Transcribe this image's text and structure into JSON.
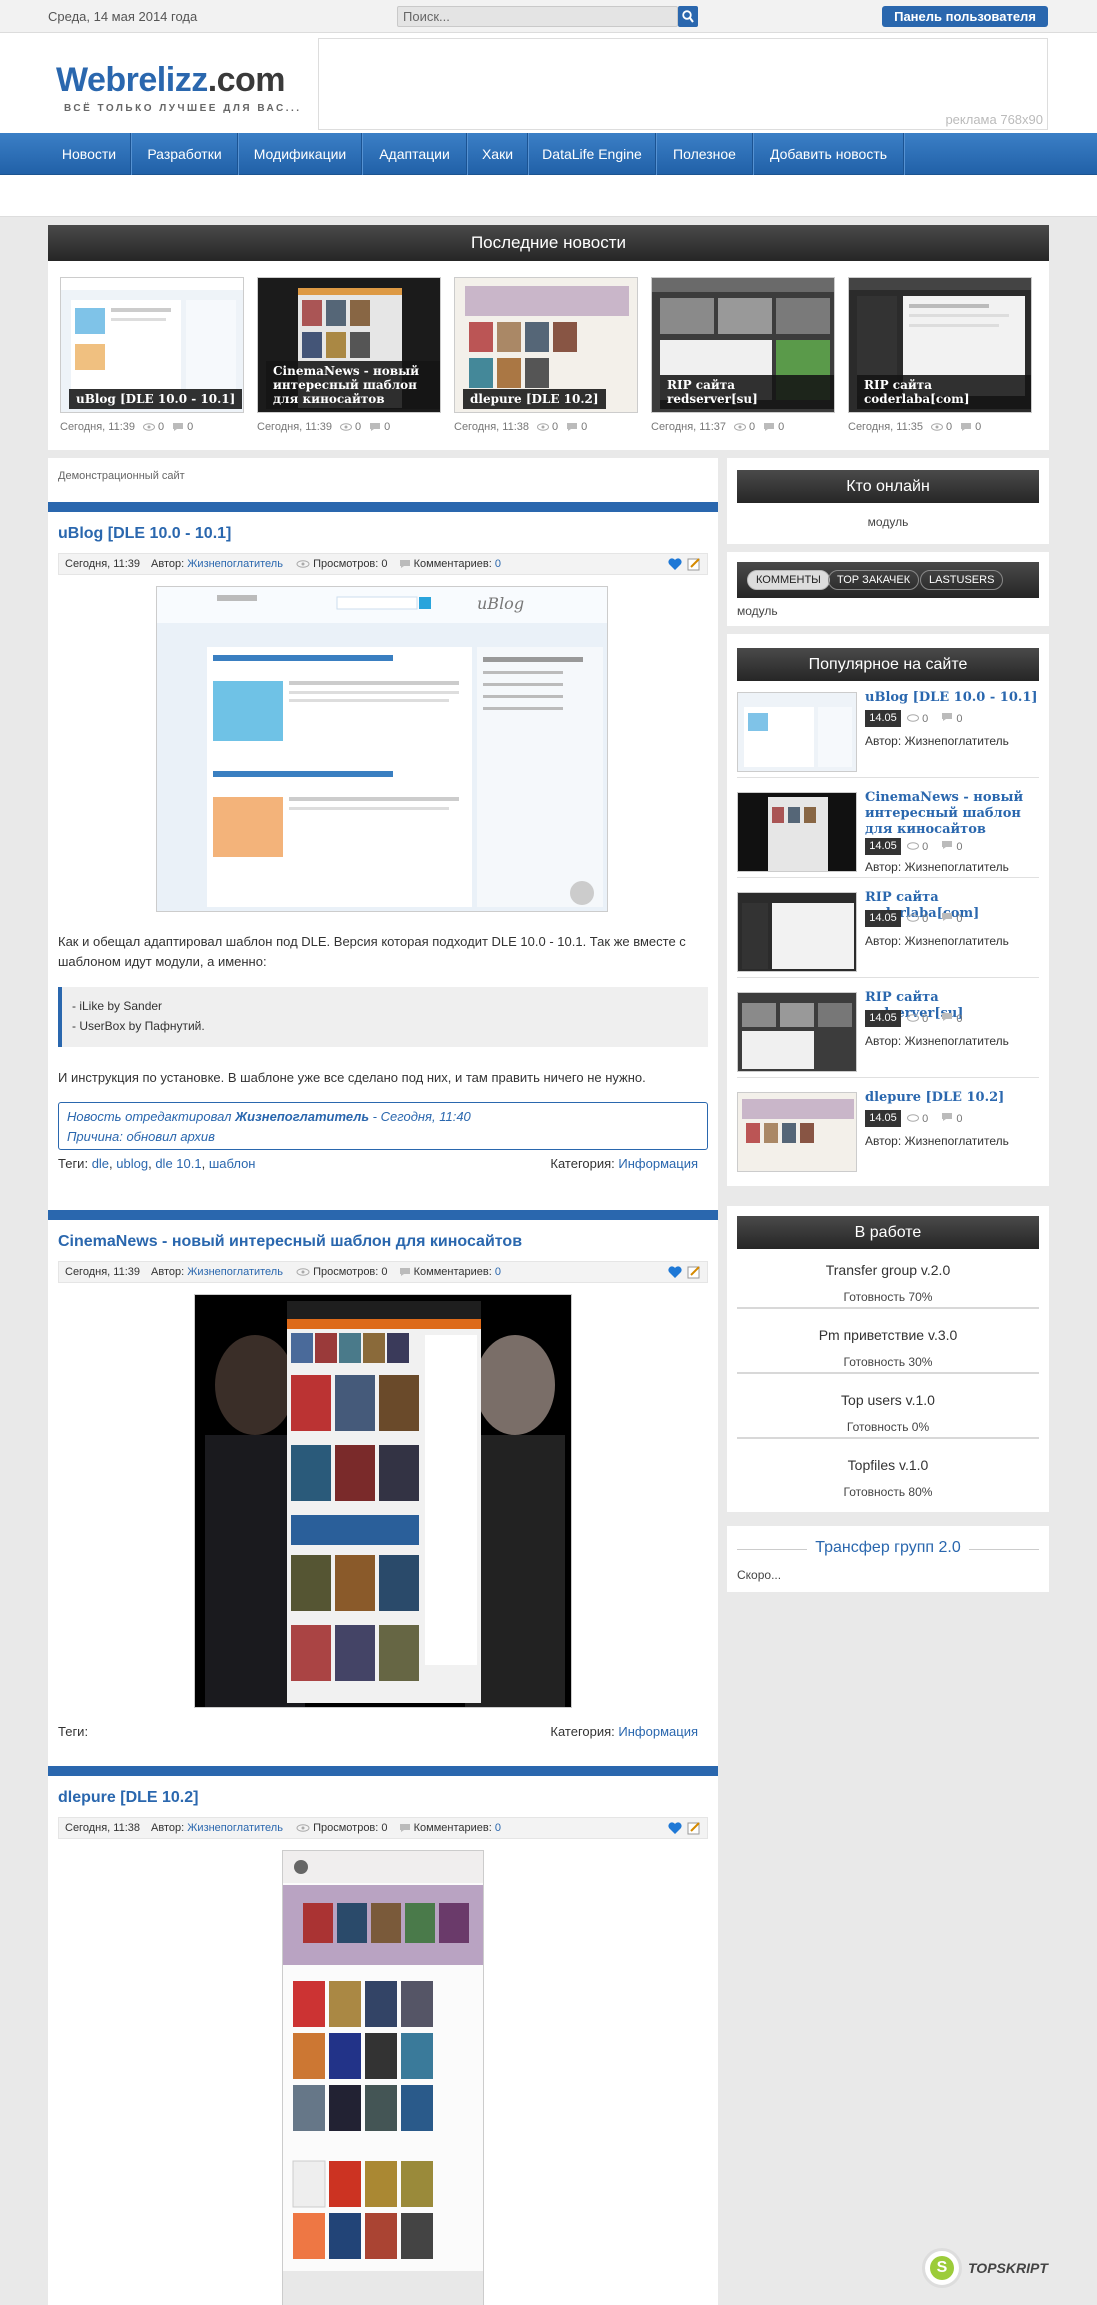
{
  "topbar": {
    "date": "Среда, 14 мая 2014 года",
    "search_placeholder": "Поиск...",
    "user_panel": "Панель пользователя"
  },
  "header": {
    "logo_main": "Webrelizz",
    "logo_dot": ".com",
    "slogan": "ВСЁ ТОЛЬКО ЛУЧШЕЕ ДЛЯ ВАС...",
    "ad_label": "реклама 768x90"
  },
  "nav": [
    "Новости",
    "Разработки",
    "Модификации",
    "Адаптации",
    "Хаки",
    "DataLife Engine",
    "Полезное",
    "Добавить новость"
  ],
  "latest": {
    "title": "Последние новости",
    "cards": [
      {
        "caption": "uBlog [DLE 10.0 - 10.1]",
        "date": "Сегодня, 11:39",
        "views": "0",
        "comments": "0"
      },
      {
        "caption": "CinemaNews - новый интересный шаблон для киносайтов",
        "date": "Сегодня, 11:39",
        "views": "0",
        "comments": "0"
      },
      {
        "caption": "dlepure [DLE 10.2]",
        "date": "Сегодня, 11:38",
        "views": "0",
        "comments": "0"
      },
      {
        "caption": "RIP сайта redserver[su]",
        "date": "Сегодня, 11:37",
        "views": "0",
        "comments": "0"
      },
      {
        "caption": "RIP сайта coderlaba[com]",
        "date": "Сегодня, 11:35",
        "views": "0",
        "comments": "0"
      }
    ]
  },
  "demo_label": "Демонстрационный сайт",
  "posts": [
    {
      "title": "uBlog [DLE 10.0 - 10.1]",
      "date": "Сегодня, 11:39",
      "author_label": "Автор:",
      "author": "Жизнепоглатитель",
      "views_label": "Просмотров: 0",
      "comments_label": "Комментариев:",
      "comments": "0",
      "text1": "Как и обещал адаптировал шаблон под DLE. Версия которая подходит DLE 10.0 - 10.1. Так же вместе с шаблоном идут модули, а именно:",
      "quote1": "- iLike by Sander",
      "quote2": "- UserBox by Пафнутий.",
      "text2": "И инструкция по установке. В шаблоне уже все сделано под них, и там править ничего не нужно.",
      "edited_prefix": "Новость отредактировал ",
      "edited_author": "Жизнепоглатитель",
      "edited_suffix": " - Сегодня, 11:40",
      "edited_reason": "Причина: обновил архив",
      "tags_label": "Теги:",
      "tags": [
        "dle",
        "ublog",
        "dle 10.1",
        "шаблон"
      ],
      "cat_label": "Категория:",
      "category": "Информация"
    },
    {
      "title": "CinemaNews - новый интересный шаблон для киносайтов",
      "date": "Сегодня, 11:39",
      "author_label": "Автор:",
      "author": "Жизнепоглатитель",
      "views_label": "Просмотров: 0",
      "comments_label": "Комментариев:",
      "comments": "0",
      "tags_label": "Теги:",
      "cat_label": "Категория:",
      "category": "Информация"
    },
    {
      "title": "dlepure [DLE 10.2]",
      "date": "Сегодня, 11:38",
      "author_label": "Автор:",
      "author": "Жизнепоглатитель",
      "views_label": "Просмотров: 0",
      "comments_label": "Комментариев:",
      "comments": "0"
    }
  ],
  "sidebar": {
    "online": {
      "title": "Кто онлайн",
      "note": "модуль"
    },
    "tabs": {
      "items": [
        "КОММЕНТЫ",
        "ТОР ЗАКАЧЕК",
        "LASTUSERS"
      ],
      "note": "модуль"
    },
    "popular": {
      "title": "Популярное на сайте",
      "items": [
        {
          "title": "uBlog [DLE 10.0 - 10.1]",
          "date": "14.05",
          "views": "0",
          "comments": "0",
          "author": "Автор: Жизнепоглатитель"
        },
        {
          "title": "CinemaNews - новый интересный шаблон для киносайтов",
          "date": "14.05",
          "views": "0",
          "comments": "0",
          "author": "Автор: Жизнепоглатитель"
        },
        {
          "title": "RIP сайта coderlaba[com]",
          "date": "14.05",
          "views": "0",
          "comments": "0",
          "author": "Автор: Жизнепоглатитель"
        },
        {
          "title": "RIP сайта redserver[su]",
          "date": "14.05",
          "views": "0",
          "comments": "0",
          "author": "Автор: Жизнепоглатитель"
        },
        {
          "title": "dlepure [DLE 10.2]",
          "date": "14.05",
          "views": "0",
          "comments": "0",
          "author": "Автор: Жизнепоглатитель"
        }
      ]
    },
    "work": {
      "title": "В работе",
      "items": [
        {
          "name": "Transfer group v.2.0",
          "progress": "Готовность 70%"
        },
        {
          "name": "Pm приветствие v.3.0",
          "progress": "Готовность 30%"
        },
        {
          "name": "Top users v.1.0",
          "progress": "Готовность 0%"
        },
        {
          "name": "Topfiles v.1.0",
          "progress": "Готовность 80%"
        }
      ]
    },
    "transfer": {
      "title": "Трансфер групп 2.0",
      "note": "Скоро..."
    }
  },
  "watermark": {
    "text": "TOPSKRIPT",
    "letter": "S"
  },
  "colors": {
    "accent": "#2a67ae",
    "dark": "#2b2b2b"
  }
}
